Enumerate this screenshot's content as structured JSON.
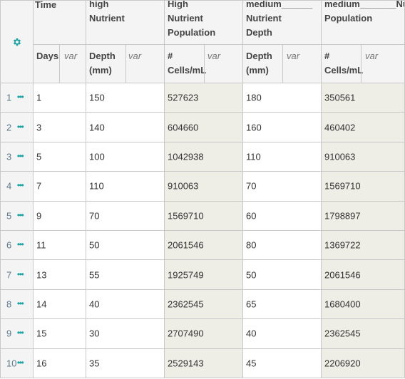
{
  "colors": {
    "accent": "#1aa3a3",
    "header_bg": "#f4f4f4",
    "computed_bg": "#eeede6",
    "border": "#c8c8c8"
  },
  "settings_icon": "gear-icon",
  "attributes": [
    {
      "title": "Time",
      "has_menu": false
    },
    {
      "title": "high\nNutrient",
      "has_menu": true
    },
    {
      "title": "High\nNutrient\nPopulation",
      "has_menu": true
    },
    {
      "title": "medium______\nNutrient\nDepth",
      "has_menu": true
    },
    {
      "title": "medium_______Nu\nPopulation",
      "has_menu": true
    }
  ],
  "columns": [
    {
      "name": "Days",
      "type": "var"
    },
    {
      "name": "Depth\n(mm)",
      "type": "var"
    },
    {
      "name": "#\nCells/mL",
      "type": "var"
    },
    {
      "name": "Depth\n(mm)",
      "type": "var"
    },
    {
      "name": "#\nCells/mL",
      "type": "var"
    }
  ],
  "row_menu_glyph": "•••",
  "rows": [
    {
      "index": "1",
      "cells": [
        "1",
        "150",
        "527623",
        "180",
        "350561"
      ]
    },
    {
      "index": "2",
      "cells": [
        "3",
        "140",
        "604660",
        "160",
        "460402"
      ]
    },
    {
      "index": "3",
      "cells": [
        "5",
        "100",
        "1042938",
        "110",
        "910063"
      ]
    },
    {
      "index": "4",
      "cells": [
        "7",
        "110",
        "910063",
        "70",
        "1569710"
      ]
    },
    {
      "index": "5",
      "cells": [
        "9",
        "70",
        "1569710",
        "60",
        "1798897"
      ]
    },
    {
      "index": "6",
      "cells": [
        "11",
        "50",
        "2061546",
        "80",
        "1369722"
      ]
    },
    {
      "index": "7",
      "cells": [
        "13",
        "55",
        "1925749",
        "50",
        "2061546"
      ]
    },
    {
      "index": "8",
      "cells": [
        "14",
        "40",
        "2362545",
        "65",
        "1680400"
      ]
    },
    {
      "index": "9",
      "cells": [
        "15",
        "30",
        "2707490",
        "40",
        "2362545"
      ]
    },
    {
      "index": "10",
      "cells": [
        "16",
        "35",
        "2529143",
        "45",
        "2206920"
      ]
    }
  ]
}
